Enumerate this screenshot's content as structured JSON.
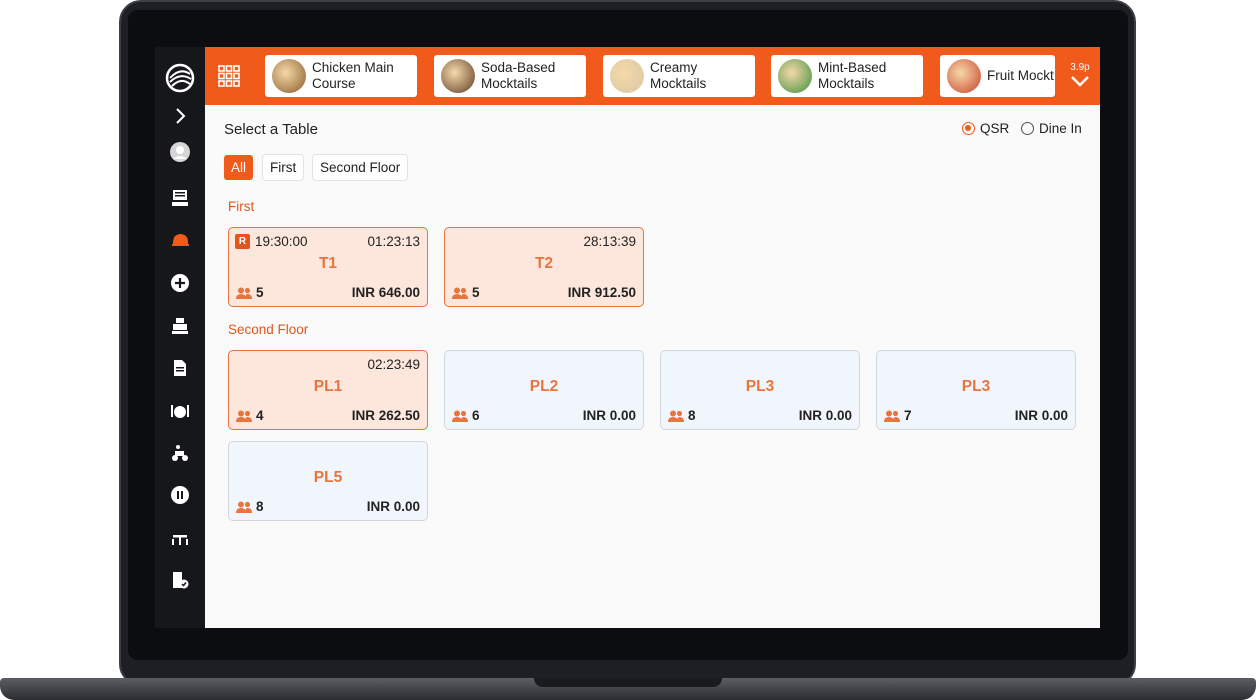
{
  "topbar": {
    "categories": [
      {
        "label": "Chicken Main\nCourse",
        "thumb_color": "#8a5a2b"
      },
      {
        "label": "Soda-Based\nMocktails",
        "thumb_color": "#5b3a26"
      },
      {
        "label": "Creamy\nMocktails",
        "thumb_color": "#d9c7a6"
      },
      {
        "label": "Mint-Based\nMocktails",
        "thumb_color": "#3f8f3a"
      },
      {
        "label": "Fruit Mockt",
        "thumb_color": "#c9412b"
      }
    ],
    "more_badge": "3.9p"
  },
  "content": {
    "title": "Select a Table",
    "modes": [
      {
        "label": "QSR",
        "selected": true
      },
      {
        "label": "Dine In",
        "selected": false
      }
    ],
    "filters": [
      {
        "label": "All",
        "active": true
      },
      {
        "label": "First",
        "active": false
      },
      {
        "label": "Second Floor",
        "active": false
      }
    ],
    "sections": [
      {
        "name": "First",
        "tables": [
          {
            "name": "T1",
            "reserved_badge": "R",
            "reserved_time": "19:30:00",
            "elapsed": "01:23:13",
            "guests": "5",
            "amount": "INR 646.00",
            "status": "busy"
          },
          {
            "name": "T2",
            "reserved_badge": "",
            "reserved_time": "",
            "elapsed": "28:13:39",
            "guests": "5",
            "amount": "INR 912.50",
            "status": "busy"
          }
        ]
      },
      {
        "name": "Second Floor",
        "tables": [
          {
            "name": "PL1",
            "reserved_badge": "",
            "reserved_time": "",
            "elapsed": "02:23:49",
            "guests": "4",
            "amount": "INR 262.50",
            "status": "busy"
          },
          {
            "name": "PL2",
            "reserved_badge": "",
            "reserved_time": "",
            "elapsed": "",
            "guests": "6",
            "amount": "INR 0.00",
            "status": "free"
          },
          {
            "name": "PL3",
            "reserved_badge": "",
            "reserved_time": "",
            "elapsed": "",
            "guests": "8",
            "amount": "INR 0.00",
            "status": "free"
          },
          {
            "name": "PL3",
            "reserved_badge": "",
            "reserved_time": "",
            "elapsed": "",
            "guests": "7",
            "amount": "INR 0.00",
            "status": "free"
          },
          {
            "name": "PL5",
            "reserved_badge": "",
            "reserved_time": "",
            "elapsed": "",
            "guests": "8",
            "amount": "INR 0.00",
            "status": "free"
          }
        ]
      }
    ]
  },
  "sidebar": {
    "icons": [
      "logo-icon",
      "chevron-right-icon",
      "avatar-icon",
      "pos-terminal-icon",
      "delivery-helmet-icon",
      "add-circle-icon",
      "cash-register-icon",
      "document-icon",
      "dine-plate-icon",
      "delivery-scooter-icon",
      "pause-circle-icon",
      "table-dining-icon",
      "report-check-icon"
    ],
    "accent": "#f05a1a"
  },
  "colors": {
    "brand": "#f05a1a",
    "busy_bg": "#fde7dc",
    "free_bg": "#f1f6fc"
  }
}
